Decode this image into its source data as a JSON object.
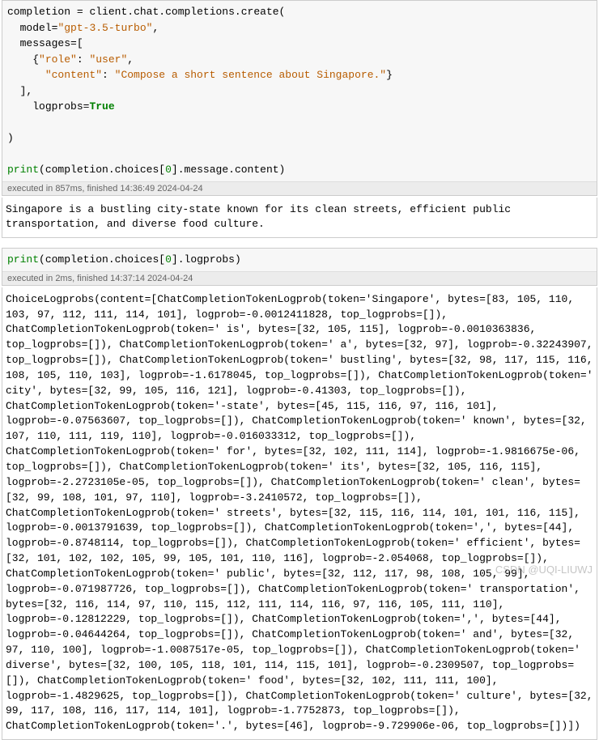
{
  "cell1": {
    "code_tokens": [
      {
        "t": "completion ",
        "c": "tk-default"
      },
      {
        "t": "=",
        "c": "tk-punct"
      },
      {
        "t": " client",
        "c": "tk-default"
      },
      {
        "t": ".",
        "c": "tk-punct"
      },
      {
        "t": "chat",
        "c": "tk-default"
      },
      {
        "t": ".",
        "c": "tk-punct"
      },
      {
        "t": "completions",
        "c": "tk-default"
      },
      {
        "t": ".",
        "c": "tk-punct"
      },
      {
        "t": "create",
        "c": "tk-default"
      },
      {
        "t": "(",
        "c": "tk-punct"
      },
      {
        "t": "\n",
        "c": ""
      },
      {
        "t": "  model",
        "c": "tk-kwarg"
      },
      {
        "t": "=",
        "c": "tk-punct"
      },
      {
        "t": "\"gpt-3.5-turbo\"",
        "c": "tk-str"
      },
      {
        "t": ",",
        "c": "tk-punct"
      },
      {
        "t": "\n",
        "c": ""
      },
      {
        "t": "  messages",
        "c": "tk-kwarg"
      },
      {
        "t": "=",
        "c": "tk-punct"
      },
      {
        "t": "[",
        "c": "tk-punct"
      },
      {
        "t": "\n",
        "c": ""
      },
      {
        "t": "    {",
        "c": "tk-punct"
      },
      {
        "t": "\"role\"",
        "c": "tk-str"
      },
      {
        "t": ": ",
        "c": "tk-punct"
      },
      {
        "t": "\"user\"",
        "c": "tk-str"
      },
      {
        "t": ",",
        "c": "tk-punct"
      },
      {
        "t": "\n",
        "c": ""
      },
      {
        "t": "      ",
        "c": ""
      },
      {
        "t": "\"content\"",
        "c": "tk-str"
      },
      {
        "t": ": ",
        "c": "tk-punct"
      },
      {
        "t": "\"Compose a short sentence about Singapore.\"",
        "c": "tk-str"
      },
      {
        "t": "}",
        "c": "tk-punct"
      },
      {
        "t": "\n",
        "c": ""
      },
      {
        "t": "  ],",
        "c": "tk-punct"
      },
      {
        "t": "\n",
        "c": ""
      },
      {
        "t": "    logprobs",
        "c": "tk-kwarg"
      },
      {
        "t": "=",
        "c": "tk-punct"
      },
      {
        "t": "True",
        "c": "tk-true"
      },
      {
        "t": "\n",
        "c": ""
      },
      {
        "t": "\n",
        "c": ""
      },
      {
        "t": ")",
        "c": "tk-punct"
      },
      {
        "t": "\n",
        "c": ""
      },
      {
        "t": "\n",
        "c": ""
      },
      {
        "t": "print",
        "c": "tk-print"
      },
      {
        "t": "(",
        "c": "tk-punct"
      },
      {
        "t": "completion",
        "c": "tk-default"
      },
      {
        "t": ".",
        "c": "tk-punct"
      },
      {
        "t": "choices",
        "c": "tk-default"
      },
      {
        "t": "[",
        "c": "tk-punct"
      },
      {
        "t": "0",
        "c": "tk-num"
      },
      {
        "t": "]",
        "c": "tk-punct"
      },
      {
        "t": ".",
        "c": "tk-punct"
      },
      {
        "t": "message",
        "c": "tk-default"
      },
      {
        "t": ".",
        "c": "tk-punct"
      },
      {
        "t": "content",
        "c": "tk-default"
      },
      {
        "t": ")",
        "c": "tk-punct"
      }
    ],
    "exec": "executed in 857ms, finished 14:36:49 2024-04-24",
    "output": "Singapore is a bustling city-state known for its clean streets, efficient public transportation, and diverse food culture."
  },
  "cell2": {
    "code_tokens": [
      {
        "t": "print",
        "c": "tk-print"
      },
      {
        "t": "(",
        "c": "tk-punct"
      },
      {
        "t": "completion",
        "c": "tk-default"
      },
      {
        "t": ".",
        "c": "tk-punct"
      },
      {
        "t": "choices",
        "c": "tk-default"
      },
      {
        "t": "[",
        "c": "tk-punct"
      },
      {
        "t": "0",
        "c": "tk-num"
      },
      {
        "t": "]",
        "c": "tk-punct"
      },
      {
        "t": ".",
        "c": "tk-punct"
      },
      {
        "t": "logprobs",
        "c": "tk-default"
      },
      {
        "t": ")",
        "c": "tk-punct"
      }
    ],
    "exec": "executed in 2ms, finished 14:37:14 2024-04-24",
    "output": "ChoiceLogprobs(content=[ChatCompletionTokenLogprob(token='Singapore', bytes=[83, 105, 110, 103, 97, 112, 111, 114, 101], logprob=-0.0012411828, top_logprobs=[]), ChatCompletionTokenLogprob(token=' is', bytes=[32, 105, 115], logprob=-0.0010363836, top_logprobs=[]), ChatCompletionTokenLogprob(token=' a', bytes=[32, 97], logprob=-0.32243907, top_logprobs=[]), ChatCompletionTokenLogprob(token=' bustling', bytes=[32, 98, 117, 115, 116, 108, 105, 110, 103], logprob=-1.6178045, top_logprobs=[]), ChatCompletionTokenLogprob(token=' city', bytes=[32, 99, 105, 116, 121], logprob=-0.41303, top_logprobs=[]), ChatCompletionTokenLogprob(token='-state', bytes=[45, 115, 116, 97, 116, 101], logprob=-0.07563607, top_logprobs=[]), ChatCompletionTokenLogprob(token=' known', bytes=[32, 107, 110, 111, 119, 110], logprob=-0.016033312, top_logprobs=[]), ChatCompletionTokenLogprob(token=' for', bytes=[32, 102, 111, 114], logprob=-1.9816675e-06, top_logprobs=[]), ChatCompletionTokenLogprob(token=' its', bytes=[32, 105, 116, 115], logprob=-2.2723105e-05, top_logprobs=[]), ChatCompletionTokenLogprob(token=' clean', bytes=[32, 99, 108, 101, 97, 110], logprob=-3.2410572, top_logprobs=[]), ChatCompletionTokenLogprob(token=' streets', bytes=[32, 115, 116, 114, 101, 101, 116, 115], logprob=-0.0013791639, top_logprobs=[]), ChatCompletionTokenLogprob(token=',', bytes=[44], logprob=-0.8748114, top_logprobs=[]), ChatCompletionTokenLogprob(token=' efficient', bytes=[32, 101, 102, 102, 105, 99, 105, 101, 110, 116], logprob=-2.054068, top_logprobs=[]), ChatCompletionTokenLogprob(token=' public', bytes=[32, 112, 117, 98, 108, 105, 99], logprob=-0.071987726, top_logprobs=[]), ChatCompletionTokenLogprob(token=' transportation', bytes=[32, 116, 114, 97, 110, 115, 112, 111, 114, 116, 97, 116, 105, 111, 110], logprob=-0.12812229, top_logprobs=[]), ChatCompletionTokenLogprob(token=',', bytes=[44], logprob=-0.04644264, top_logprobs=[]), ChatCompletionTokenLogprob(token=' and', bytes=[32, 97, 110, 100], logprob=-1.0087517e-05, top_logprobs=[]), ChatCompletionTokenLogprob(token=' diverse', bytes=[32, 100, 105, 118, 101, 114, 115, 101], logprob=-0.2309507, top_logprobs=[]), ChatCompletionTokenLogprob(token=' food', bytes=[32, 102, 111, 111, 100], logprob=-1.4829625, top_logprobs=[]), ChatCompletionTokenLogprob(token=' culture', bytes=[32, 99, 117, 108, 116, 117, 114, 101], logprob=-1.7752873, top_logprobs=[]), ChatCompletionTokenLogprob(token='.', bytes=[46], logprob=-9.729906e-06, top_logprobs=[])])"
  },
  "watermark": "CSDN @UQI-LIUWJ"
}
